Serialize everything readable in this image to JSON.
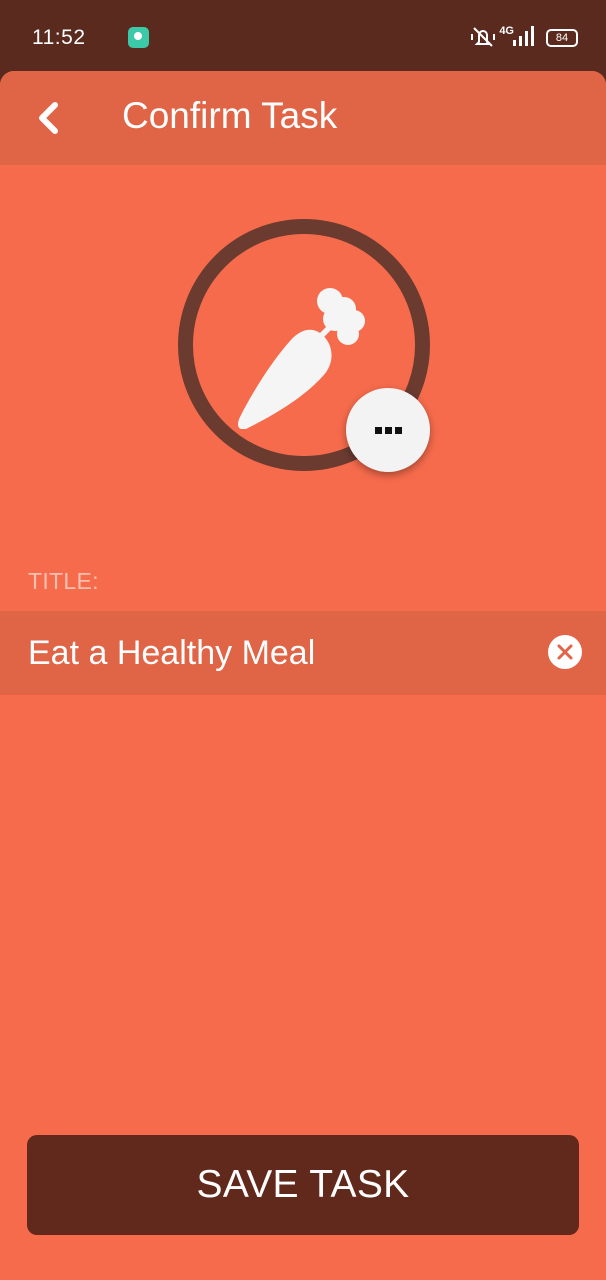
{
  "status_bar": {
    "time": "11:52",
    "network": "4G",
    "battery": "84",
    "icons": [
      "app-notification-icon",
      "vibrate-mute-icon",
      "signal-icon",
      "battery-icon"
    ]
  },
  "header": {
    "title": "Confirm Task",
    "back_icon": "chevron-left-icon"
  },
  "task_icon": {
    "name": "carrot-icon",
    "more_icon": "ellipsis-icon"
  },
  "form": {
    "title_label": "TITLE:",
    "title_value": "Eat a Healthy Meal",
    "clear_icon": "clear-circle-icon"
  },
  "actions": {
    "save_label": "SAVE TASK"
  },
  "colors": {
    "background": "#f66b4c",
    "header": "#e06446",
    "ring": "#6b3b30",
    "button": "#61281c",
    "status_bar": "#5a2a1f"
  }
}
